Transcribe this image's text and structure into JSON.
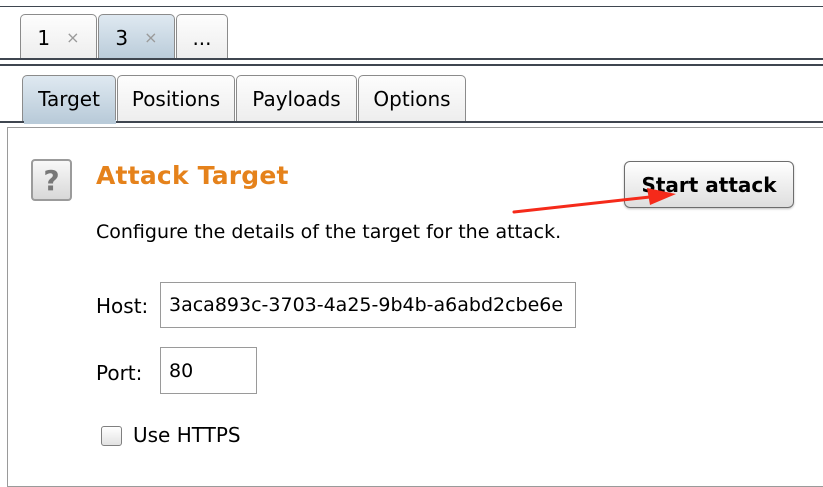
{
  "instance_tabs": [
    {
      "label": "1",
      "close": "×"
    },
    {
      "label": "3",
      "close": "×"
    },
    {
      "label": "..."
    }
  ],
  "sub_tabs": [
    "Target",
    "Positions",
    "Payloads",
    "Options"
  ],
  "panel": {
    "help_glyph": "?",
    "title": "Attack Target",
    "start_button": "Start attack",
    "description": "Configure the details of the target for the attack.",
    "host_label": "Host:",
    "host_value": "3aca893c-3703-4a25-9b4b-a6abd2cbe6e",
    "port_label": "Port:",
    "port_value": "80",
    "https_label": "Use HTTPS",
    "https_checked": false
  },
  "colors": {
    "title": "#e5821b",
    "arrow": "#f52a1a",
    "active_tab": "#b9cbd9"
  }
}
